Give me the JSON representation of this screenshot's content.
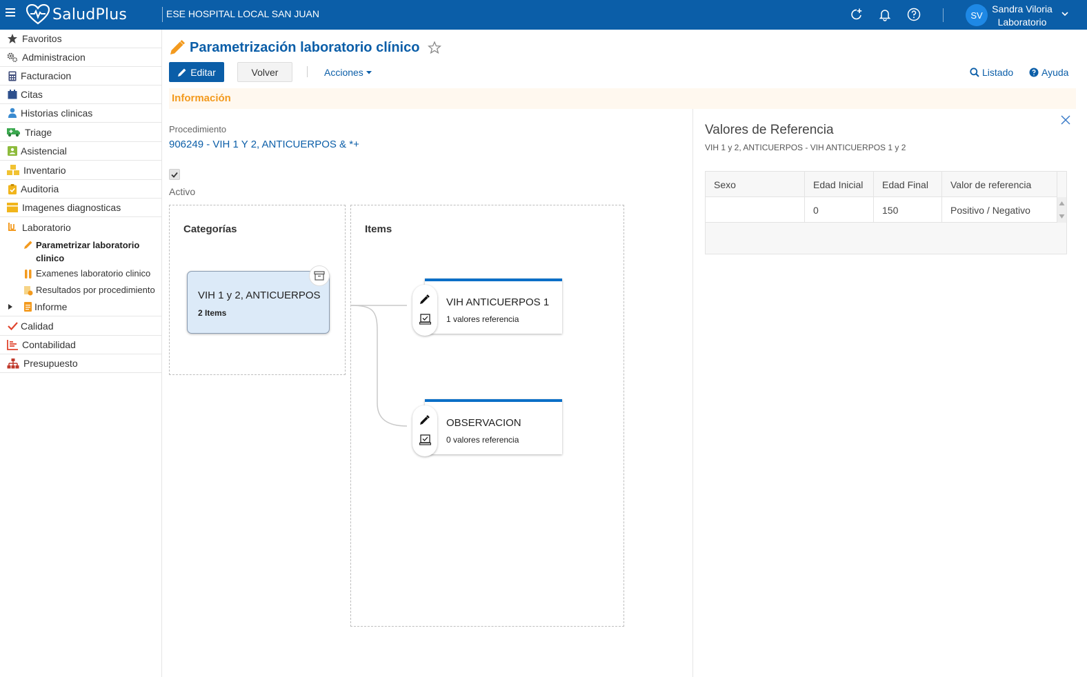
{
  "topbar": {
    "app_name": "SaludPlus",
    "hospital": "ESE HOSPITAL LOCAL SAN JUAN",
    "user_initials": "SV",
    "user_name": "Sandra Viloria",
    "user_role": "Laboratorio"
  },
  "sidebar": {
    "items": [
      {
        "label": "Favoritos",
        "icon": "star-icon"
      },
      {
        "label": "Administracion",
        "icon": "gears-icon"
      },
      {
        "label": "Facturacion",
        "icon": "calculator-icon"
      },
      {
        "label": "Citas",
        "icon": "calendar-icon"
      },
      {
        "label": "Historias clinicas",
        "icon": "doctor-icon"
      },
      {
        "label": "Triage",
        "icon": "ambulance-icon"
      },
      {
        "label": "Asistencial",
        "icon": "id-card-icon"
      },
      {
        "label": "Inventario",
        "icon": "cubes-icon"
      },
      {
        "label": "Auditoria",
        "icon": "clipboard-check-icon"
      },
      {
        "label": "Imagenes diagnosticas",
        "icon": "image-icon"
      },
      {
        "label": "Laboratorio",
        "icon": "flask-icon"
      }
    ],
    "sub_items": [
      {
        "label": "Parametrizar laboratorio clinico",
        "icon": "pencil-icon"
      },
      {
        "label": "Examenes laboratorio clinico",
        "icon": "test-tubes-icon"
      },
      {
        "label": "Resultados por procedimiento",
        "icon": "document-result-icon"
      }
    ],
    "informe": "Informe",
    "bottom_items": [
      {
        "label": "Calidad",
        "icon": "check-icon"
      },
      {
        "label": "Contabilidad",
        "icon": "bar-chart-icon"
      },
      {
        "label": "Presupuesto",
        "icon": "sitemap-icon"
      }
    ]
  },
  "page": {
    "title": "Parametrización laboratorio clínico",
    "edit_label": "Editar",
    "back_label": "Volver",
    "actions_label": "Acciones",
    "list_label": "Listado",
    "help_label": "Ayuda",
    "section_label": "Información",
    "procedure_label": "Procedimiento",
    "procedure_value": "906249 - VIH 1 Y 2, ANTICUERPOS & *+",
    "active_label": "Activo",
    "active_checked": true
  },
  "diagram": {
    "categories_title": "Categorías",
    "items_title": "Items",
    "category": {
      "name": "VIH 1 y 2, ANTICUERPOS",
      "count": "2 Items"
    },
    "items": [
      {
        "name": "VIH ANTICUERPOS 1",
        "sub": "1 valores referencia"
      },
      {
        "name": "OBSERVACION",
        "sub": "0 valores referencia"
      }
    ]
  },
  "panel": {
    "title": "Valores de Referencia",
    "subtitle": "VIH 1 y 2, ANTICUERPOS - VIH ANTICUERPOS 1 y 2",
    "columns": [
      "Sexo",
      "Edad Inicial",
      "Edad Final",
      "Valor de referencia"
    ],
    "rows": [
      [
        "",
        "0",
        "150",
        "Positivo / Negativo"
      ]
    ]
  },
  "colors": {
    "brand": "#0b5ea8",
    "accent_orange": "#f39a1e",
    "category_fill": "#dceaf8",
    "item_border": "#0b6fc7"
  }
}
